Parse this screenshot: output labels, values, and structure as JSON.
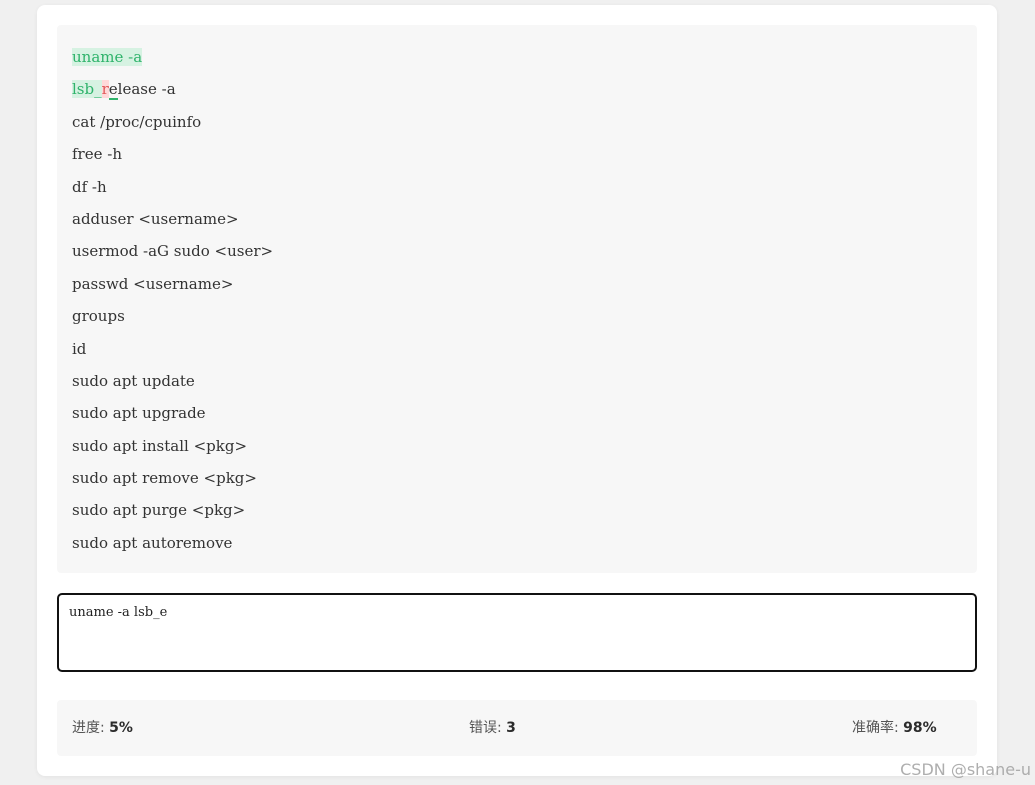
{
  "lines": [
    "uname -a",
    "lsb_release -a",
    "cat /proc/cpuinfo",
    "free -h",
    "df -h",
    "adduser <username>",
    "usermod -aG sudo <user>",
    "passwd <username>",
    "groups",
    "id",
    "sudo apt update",
    "sudo apt upgrade",
    "sudo apt install <pkg>",
    "sudo apt remove <pkg>",
    "sudo apt purge <pkg>",
    "sudo apt autoremove"
  ],
  "typed_input": "uname -a lsb_e",
  "highlight": {
    "line1_correct": "uname -a",
    "line2_correct": "lsb_",
    "line2_error": "r",
    "line2_current": "e",
    "line2_rest": "lease -a"
  },
  "stats": {
    "progress_label": "进度: ",
    "progress_value": "5%",
    "errors_label": "错误: ",
    "errors_value": "3",
    "accuracy_label": "准确率: ",
    "accuracy_value": "98%"
  },
  "watermark": "CSDN @shane-u",
  "colors": {
    "correct_bg": "#d6f2e2",
    "correct_text": "#2fb36b",
    "error_bg": "#ffd9d9",
    "error_text": "#e05a5a"
  }
}
